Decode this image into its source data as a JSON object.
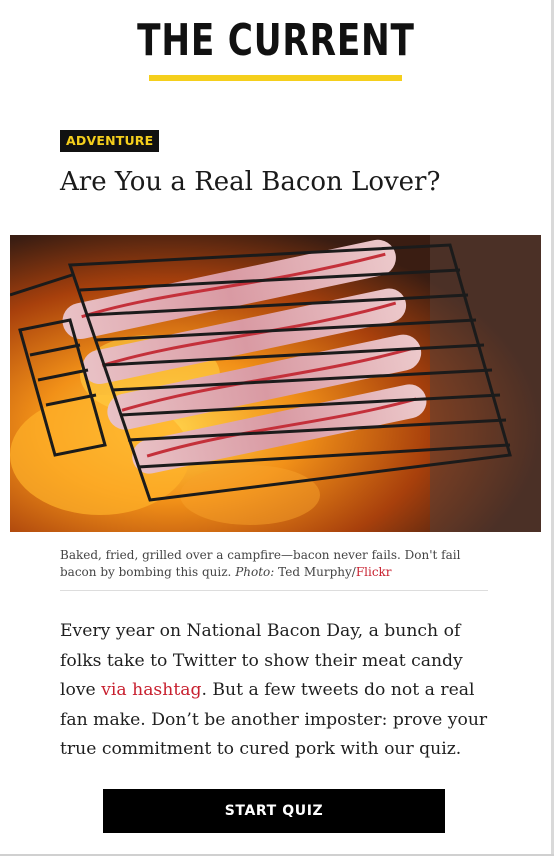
{
  "masthead": {
    "logo_text": "THE CURRENT"
  },
  "article": {
    "category": "ADVENTURE",
    "title": "Are You a Real Bacon Lover?",
    "photo_alt": "Bacon strips on a wire grill basket over a campfire",
    "caption": {
      "text": "Baked, fried, grilled over a campfire—bacon never fails. Don't fail bacon by bombing this quiz.",
      "photo_label": "Photo:",
      "photographer": "Ted Murphy/",
      "source_link": "Flickr"
    },
    "body": {
      "before_link": "Every year on National Bacon Day, a bunch of folks take to Twitter to show their meat candy love ",
      "link_text": "via hashtag",
      "after_link": ". But a few tweets do not a real fan make. Don’t be another imposter: prove your true commitment to cured pork with our quiz."
    },
    "cta_label": "START QUIZ"
  },
  "colors": {
    "accent_yellow": "#f5cf1c",
    "link_red": "#c8202f",
    "button_black": "#000000"
  }
}
